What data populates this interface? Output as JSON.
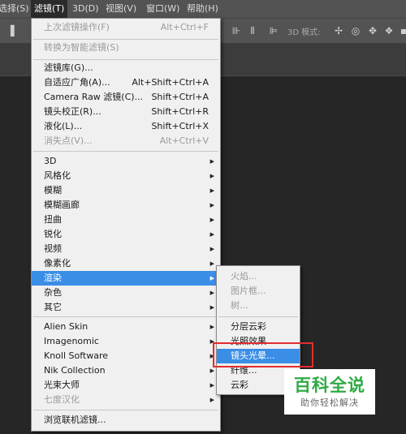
{
  "menubar": {
    "items": [
      {
        "label": "选择(S)"
      },
      {
        "label": "滤镜(T)"
      },
      {
        "label": "3D(D)"
      },
      {
        "label": "视图(V)"
      },
      {
        "label": "窗口(W)"
      },
      {
        "label": "帮助(H)"
      }
    ]
  },
  "optbar": {
    "mode_label": "3D 模式:"
  },
  "filter_menu": {
    "items": [
      {
        "label": "上次滤镜操作(F)",
        "shortcut": "Alt+Ctrl+F",
        "state": "disabled"
      },
      {
        "label": "转换为智能滤镜(S)",
        "shortcut": "",
        "state": "disabled"
      },
      {
        "label": "滤镜库(G)...",
        "shortcut": "",
        "state": "normal"
      },
      {
        "label": "自适应广角(A)...",
        "shortcut": "Alt+Shift+Ctrl+A",
        "state": "normal"
      },
      {
        "label": "Camera Raw 滤镜(C)...",
        "shortcut": "Shift+Ctrl+A",
        "state": "normal"
      },
      {
        "label": "镜头校正(R)...",
        "shortcut": "Shift+Ctrl+R",
        "state": "normal"
      },
      {
        "label": "液化(L)...",
        "shortcut": "Shift+Ctrl+X",
        "state": "normal"
      },
      {
        "label": "消失点(V)...",
        "shortcut": "Alt+Ctrl+V",
        "state": "disabled"
      },
      {
        "label": "3D",
        "state": "normal"
      },
      {
        "label": "风格化",
        "state": "normal"
      },
      {
        "label": "模糊",
        "state": "normal"
      },
      {
        "label": "模糊画廊",
        "state": "normal"
      },
      {
        "label": "扭曲",
        "state": "normal"
      },
      {
        "label": "锐化",
        "state": "normal"
      },
      {
        "label": "视频",
        "state": "normal"
      },
      {
        "label": "像素化",
        "state": "normal"
      },
      {
        "label": "渲染",
        "state": "highlighted"
      },
      {
        "label": "杂色",
        "state": "normal"
      },
      {
        "label": "其它",
        "state": "normal"
      },
      {
        "label": "Alien Skin",
        "state": "normal"
      },
      {
        "label": "Imagenomic",
        "state": "normal"
      },
      {
        "label": "Knoll Software",
        "state": "normal"
      },
      {
        "label": "Nik Collection",
        "state": "normal"
      },
      {
        "label": "光束大师",
        "state": "normal"
      },
      {
        "label": "七度汉化",
        "state": "disabled"
      },
      {
        "label": "浏览联机滤镜...",
        "state": "normal"
      }
    ]
  },
  "render_submenu": {
    "items": [
      {
        "label": "火焰...",
        "state": "disabled"
      },
      {
        "label": "图片框...",
        "state": "disabled"
      },
      {
        "label": "树...",
        "state": "disabled"
      },
      {
        "label": "分层云彩",
        "state": "normal"
      },
      {
        "label": "光照效果...",
        "state": "normal"
      },
      {
        "label": "镜头光晕...",
        "state": "highlighted"
      },
      {
        "label": "纤维...",
        "state": "normal"
      },
      {
        "label": "云彩",
        "state": "normal"
      }
    ]
  },
  "watermark": {
    "title": "百科全说",
    "subtitle": "助你轻松解决"
  },
  "colors": {
    "highlight": "#3a8ee6",
    "annotation": "#e32d2d",
    "watermark_green": "#2faa43"
  }
}
